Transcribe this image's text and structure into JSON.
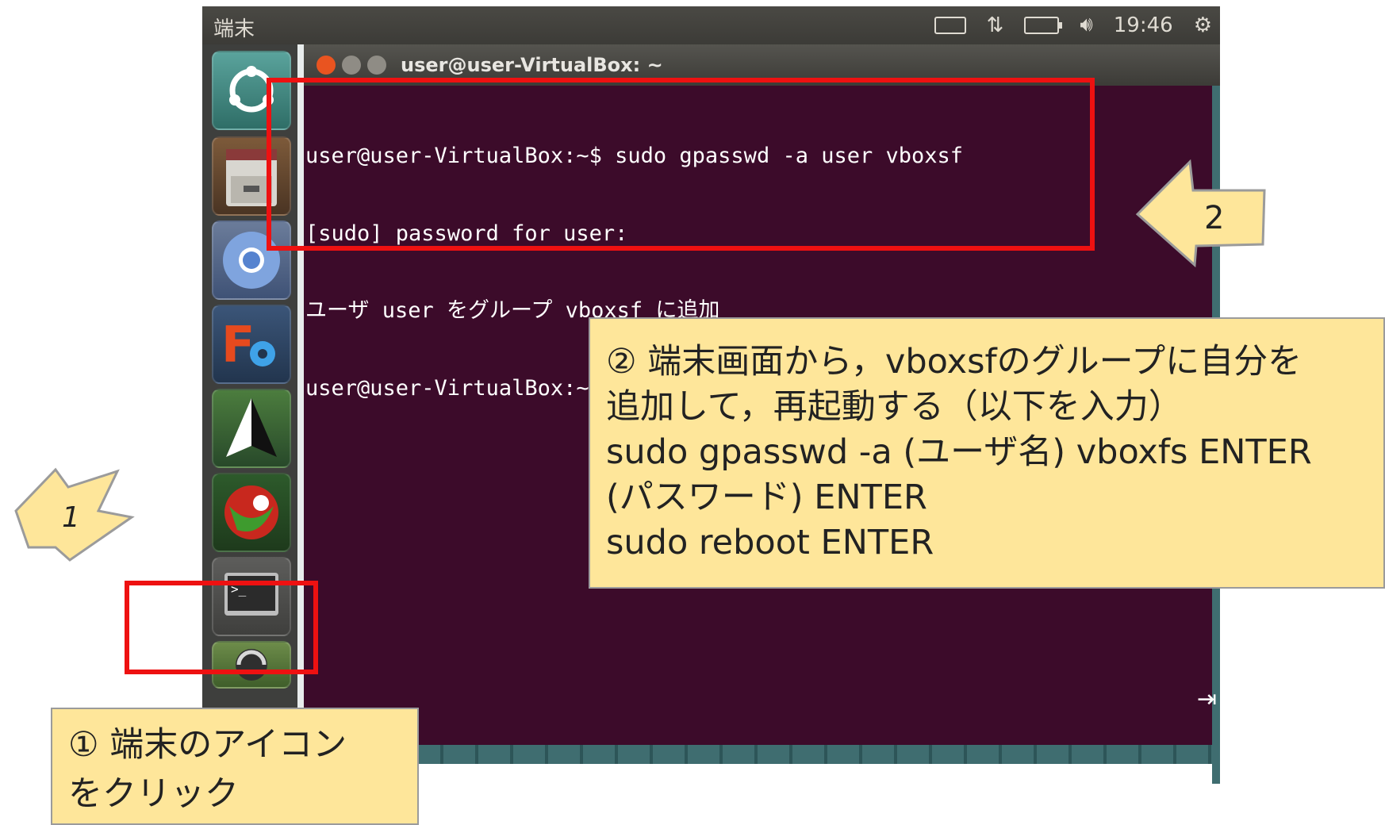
{
  "topbar": {
    "title": "端末",
    "time": "19:46"
  },
  "launcher": {
    "items": [
      {
        "name": "ubuntu-dash",
        "icon": "ubuntu-logo-icon"
      },
      {
        "name": "files",
        "icon": "file-cabinet-icon"
      },
      {
        "name": "chromium",
        "icon": "chromium-icon"
      },
      {
        "name": "font-manager",
        "icon": "f-gear-icon"
      },
      {
        "name": "inkscape",
        "icon": "triangle-icon"
      },
      {
        "name": "app",
        "icon": "red-green-ball-icon"
      },
      {
        "name": "terminal",
        "icon": "terminal-icon"
      },
      {
        "name": "updater",
        "icon": "update-icon"
      }
    ]
  },
  "terminal": {
    "window_title": "user@user-VirtualBox: ~",
    "lines": [
      "user@user-VirtualBox:~$ sudo gpasswd -a user vboxsf",
      "[sudo] password for user:",
      "ユーザ user をグループ vboxsf に追加",
      "user@user-VirtualBox:~$ sudo reboot"
    ]
  },
  "annotations": {
    "arrow1_label": "1",
    "arrow2_label": "2",
    "note1_lines": [
      "① 端末のアイコン",
      "をクリック"
    ],
    "note2_lines": [
      "② 端末画面から，vboxsfのグループに自分を",
      "追加して，再起動する（以下を入力）",
      "sudo gpasswd -a (ユーザ名) vboxfs ENTER",
      "(パスワード) ENTER",
      "sudo reboot ENTER"
    ]
  },
  "colors": {
    "terminal_bg": "#3c0b2a",
    "highlight": "#ee1111",
    "note_bg": "#fee69a"
  }
}
